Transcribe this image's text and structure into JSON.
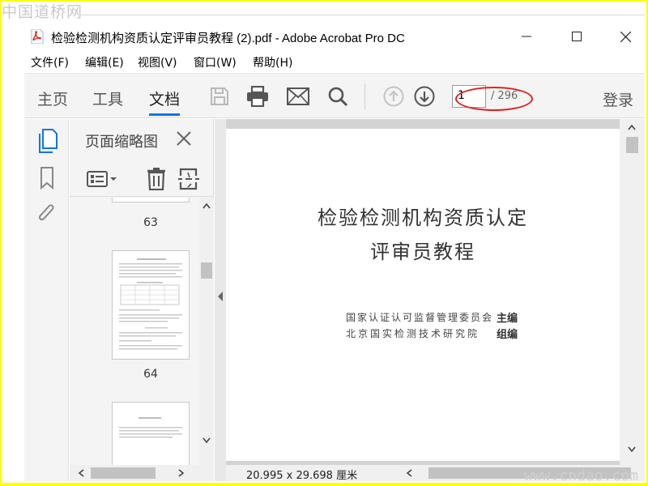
{
  "watermark": {
    "top": "中国道桥网",
    "bottom": "www.cndao.com"
  },
  "window": {
    "title": "检验检测机构资质认定评审员教程 (2).pdf - Adobe Acrobat Pro DC",
    "app_icon": "pdf-file-icon"
  },
  "menu": [
    "文件(F)",
    "编辑(E)",
    "视图(V)",
    "窗口(W)",
    "帮助(H)"
  ],
  "toolbar": {
    "tabs": [
      "主页",
      "工具",
      "文档"
    ],
    "active_tab": "文档",
    "icons": [
      "save-icon",
      "print-icon",
      "email-icon",
      "search-icon",
      "page-up-icon",
      "page-down-icon"
    ],
    "current_page": "1",
    "total_pages": "/ 296",
    "login": "登录"
  },
  "thumbnails_panel": {
    "title": "页面缩略图",
    "pages": [
      "63",
      "64"
    ]
  },
  "document": {
    "title_line1": "检验检测机构资质认定",
    "title_line2": "评审员教程",
    "org1": "国家认证认可监督管理委员会",
    "role1": "主编",
    "org2": "北京国实检测技术研究院",
    "role2": "组编",
    "page_size": "20.995 x 29.698 厘米"
  },
  "colors": {
    "accent": "#1473e6",
    "annotation": "#e02020",
    "frame": "#ffff00"
  }
}
